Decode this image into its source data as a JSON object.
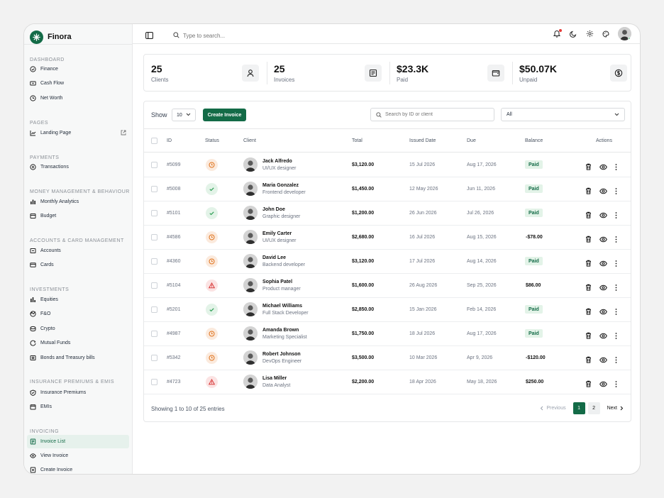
{
  "app": {
    "name": "Finora"
  },
  "search": {
    "placeholder": "Type to search..."
  },
  "sidebar": {
    "sections": [
      {
        "title": "Dashboard",
        "items": [
          "Finance",
          "Cash Flow",
          "Net Worth"
        ]
      },
      {
        "title": "Pages",
        "items": [
          "Landing Page"
        ]
      },
      {
        "title": "Payments",
        "items": [
          "Transactions"
        ]
      },
      {
        "title": "Money Management & Behaviour",
        "items": [
          "Monthly Analytics",
          "Budget"
        ]
      },
      {
        "title": "Accounts & Card Management",
        "items": [
          "Accounts",
          "Cards"
        ]
      },
      {
        "title": "Investments",
        "items": [
          "Equities",
          "F&O",
          "Crypto",
          "Mutual Funds",
          "Bonds and Treasury bills"
        ]
      },
      {
        "title": "Insurance Premiums & EMIs",
        "items": [
          "Insurance Premiums",
          "EMIs"
        ]
      },
      {
        "title": "Invoicing",
        "items": [
          "Invoice List",
          "View Invoice",
          "Create Invoice"
        ]
      }
    ],
    "active_item": "Invoice List"
  },
  "stats": [
    {
      "value": "25",
      "label": "Clients",
      "icon": "user-icon"
    },
    {
      "value": "25",
      "label": "Invoices",
      "icon": "invoice-icon"
    },
    {
      "value": "$23.3K",
      "label": "Paid",
      "icon": "wallet-icon"
    },
    {
      "value": "$50.07K",
      "label": "Unpaid",
      "icon": "dollar-icon"
    }
  ],
  "toolbar": {
    "show_label": "Show",
    "page_size": "10",
    "create_label": "Create Invoice",
    "search_placeholder": "Search by ID or client",
    "filter_value": "All"
  },
  "table": {
    "columns": [
      "ID",
      "Status",
      "Client",
      "Total",
      "Issued Date",
      "Due",
      "Balance",
      "Actions"
    ],
    "rows": [
      {
        "id": "#5099",
        "status": "pending",
        "name": "Jack Alfredo",
        "role": "UI/UX designer",
        "total": "$3,120.00",
        "issued": "15 Jul 2026",
        "due": "Aug 17, 2026",
        "balance": "Paid"
      },
      {
        "id": "#5008",
        "status": "paid",
        "name": "Maria Gonzalez",
        "role": "Frontend developer",
        "total": "$1,450.00",
        "issued": "12 May 2026",
        "due": "Jun 11, 2026",
        "balance": "Paid"
      },
      {
        "id": "#5101",
        "status": "paid",
        "name": "John Doe",
        "role": "Graphic designer",
        "total": "$1,200.00",
        "issued": "26 Jun 2026",
        "due": "Jul 26, 2026",
        "balance": "Paid"
      },
      {
        "id": "#4586",
        "status": "pending",
        "name": "Emily Carter",
        "role": "UI/UX designer",
        "total": "$2,680.00",
        "issued": "16 Jul 2026",
        "due": "Aug 15, 2026",
        "balance": "-$78.00"
      },
      {
        "id": "#4360",
        "status": "pending",
        "name": "David Lee",
        "role": "Backend developer",
        "total": "$3,120.00",
        "issued": "17 Jul 2026",
        "due": "Aug 14, 2026",
        "balance": "Paid"
      },
      {
        "id": "#5104",
        "status": "overdue",
        "name": "Sophia Patel",
        "role": "Product manager",
        "total": "$1,600.00",
        "issued": "26 Aug 2026",
        "due": "Sep 25, 2026",
        "balance": "$86.00"
      },
      {
        "id": "#5201",
        "status": "paid",
        "name": "Michael Williams",
        "role": "Full Stack Developer",
        "total": "$2,850.00",
        "issued": "15 Jan 2026",
        "due": "Feb 14, 2026",
        "balance": "Paid"
      },
      {
        "id": "#4987",
        "status": "pending",
        "name": "Amanda Brown",
        "role": "Marketing Specialist",
        "total": "$1,750.00",
        "issued": "18 Jul 2026",
        "due": "Aug 17, 2026",
        "balance": "Paid"
      },
      {
        "id": "#5342",
        "status": "pending",
        "name": "Robert Johnson",
        "role": "DevOps Engineer",
        "total": "$3,500.00",
        "issued": "10 Mar 2026",
        "due": "Apr 9, 2026",
        "balance": "-$120.00"
      },
      {
        "id": "#4723",
        "status": "overdue",
        "name": "Lisa Miller",
        "role": "Data Analyst",
        "total": "$2,200.00",
        "issued": "18 Apr 2026",
        "due": "May 18, 2026",
        "balance": "$250.00"
      }
    ]
  },
  "footer": {
    "info": "Showing 1 to 10 of 25 entries",
    "prev_label": "Previous",
    "next_label": "Next",
    "pages": [
      "1",
      "2"
    ],
    "current_page": "1"
  },
  "colors": {
    "accent": "#136b47",
    "pending": "#e0741f",
    "paid": "#2e9e55",
    "overdue": "#d83a3a"
  }
}
